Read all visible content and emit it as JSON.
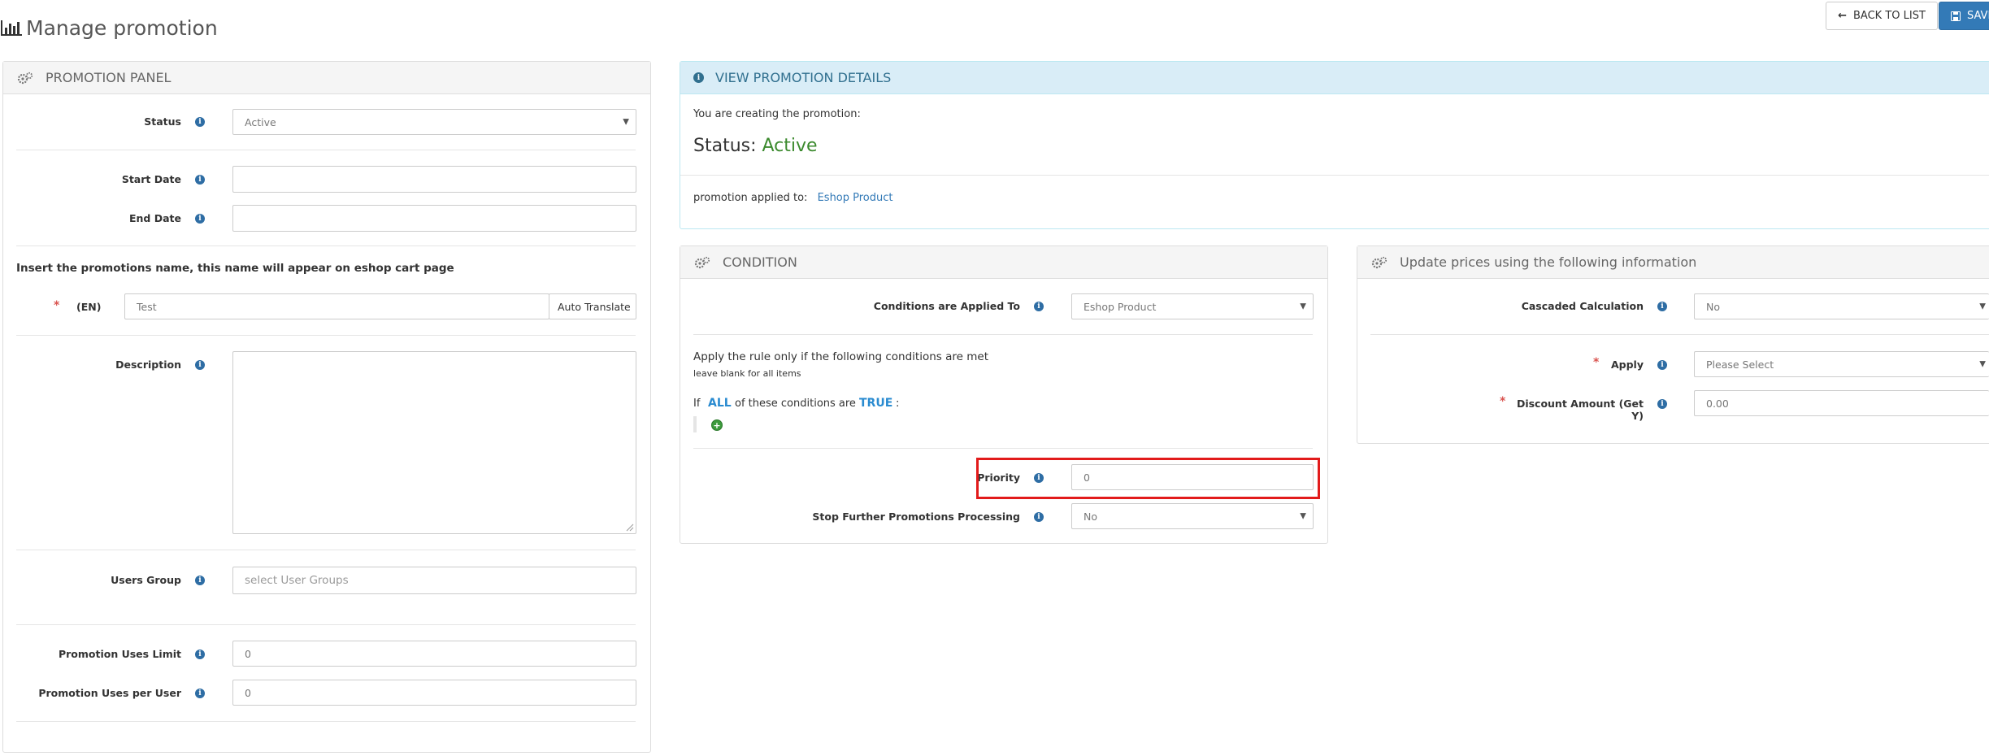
{
  "header": {
    "title": "Manage promotion",
    "back_label": "BACK TO LIST",
    "save_label": "SAVE"
  },
  "promotion_panel": {
    "title": "PROMOTION PANEL",
    "status_label": "Status",
    "status_value": "Active",
    "start_date_label": "Start Date",
    "start_date_value": "",
    "end_date_label": "End Date",
    "end_date_value": "",
    "name_instruction": "Insert the promotions name, this name will appear on eshop cart page",
    "name_lang_label": "(EN)",
    "name_value": "Test",
    "auto_translate_label": "Auto Translate",
    "description_label": "Description",
    "description_value": "",
    "users_group_label": "Users Group",
    "users_group_placeholder": "select User Groups",
    "uses_limit_label": "Promotion Uses Limit",
    "uses_limit_value": "0",
    "uses_per_user_label": "Promotion Uses per User",
    "uses_per_user_value": "0"
  },
  "view_details": {
    "title": "VIEW PROMOTION DETAILS",
    "creating_text": "You are creating the promotion:",
    "status_prefix": "Status:",
    "status_value": "Active",
    "applied_label": "promotion applied to:",
    "applied_value": "Eshop Product"
  },
  "condition": {
    "title": "CONDITION",
    "applied_to_label": "Conditions are Applied To",
    "applied_to_value": "Eshop Product",
    "rule_text": "Apply the rule only if the following conditions are met",
    "rule_hint": "leave blank for all items",
    "if_text": "If",
    "all_text": "ALL",
    "of_text": "of these conditions are",
    "true_text": "TRUE",
    "colon": ":",
    "priority_label": "Priority",
    "priority_value": "0",
    "stop_label": "Stop Further Promotions Processing",
    "stop_value": "No"
  },
  "update_prices": {
    "title": "Update prices using the following information",
    "cascaded_label": "Cascaded Calculation",
    "cascaded_value": "No",
    "apply_label": "Apply",
    "apply_value": "Please Select",
    "discount_label": "Discount Amount (Get Y)",
    "discount_value": "0.00"
  },
  "colors": {
    "accent": "#337ab7",
    "info_panel": "#d9edf7",
    "highlight": "#e21b1b",
    "active_green": "#3c8a2e"
  }
}
